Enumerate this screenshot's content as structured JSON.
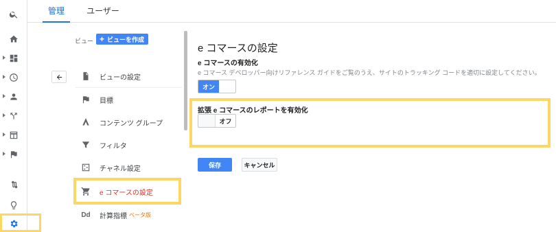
{
  "tabs": [
    {
      "label": "管理",
      "active": true
    },
    {
      "label": "ユーザー",
      "active": false
    }
  ],
  "rail": {
    "icons": [
      "search-icon",
      "home-icon",
      "dashboard-icon",
      "clock-icon",
      "person-icon",
      "share-icon",
      "table-icon",
      "flag-icon",
      "route-icon",
      "lightbulb-icon",
      "gear-icon"
    ]
  },
  "view": {
    "label": "ビュー",
    "create_button": "ビューを作成",
    "menu": [
      {
        "label": "ビューの設定",
        "icon": "document-icon"
      },
      {
        "label": "目標",
        "icon": "flag-icon"
      },
      {
        "label": "コンテンツ グループ",
        "icon": "person-walk-icon"
      },
      {
        "label": "フィルタ",
        "icon": "filter-icon"
      },
      {
        "label": "チャネル設定",
        "icon": "channel-icon"
      },
      {
        "label": "e コマースの設定",
        "icon": "cart-icon",
        "active": true
      },
      {
        "label": "計算指標",
        "icon": "dd-icon",
        "badge": "ベータ版"
      }
    ]
  },
  "main": {
    "title": "e コマースの設定",
    "enable_label": "e コマースの有効化",
    "enable_desc": "e コマース デベロッパー向けリファレンス ガイドをご覧のうえ、サイトのトラッキング コードを適切に設定してください。",
    "toggle_on_label": "オン",
    "extended_label": "拡張 e コマースのレポートを有効化",
    "toggle_off_label": "オフ",
    "save_label": "保存",
    "cancel_label": "キャンセル"
  },
  "colors": {
    "accent": "#4285f4",
    "highlight": "#fdd663",
    "active_text": "#d93025",
    "tab_active": "#1a73e8"
  }
}
